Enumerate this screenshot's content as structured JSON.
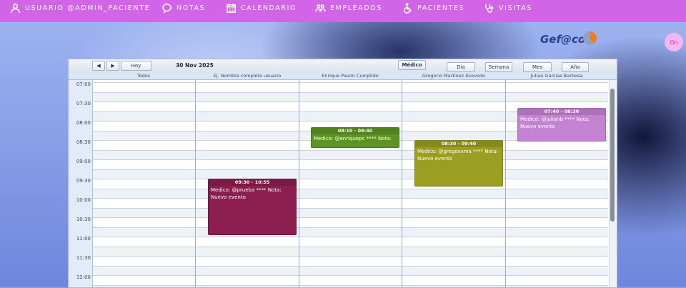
{
  "nav": [
    {
      "label": "Usuario @admin_paciente",
      "icon": "user-icon"
    },
    {
      "label": "Notas",
      "icon": "chat-bubble-icon"
    },
    {
      "label": "Calendario",
      "icon": "calendar-icon"
    },
    {
      "label": "Empleados",
      "icon": "users-icon"
    },
    {
      "label": "Pacientes",
      "icon": "wheelchair-icon"
    },
    {
      "label": "Visitas",
      "icon": "stethoscope-icon"
    }
  ],
  "brand": {
    "logo_text": "Gef@co"
  },
  "session": {
    "on_label": "On"
  },
  "toolbar": {
    "prev_label": "◀",
    "next_label": "▶",
    "today_label": "Hoy",
    "date": "30 Nov 2025",
    "filter_label": "Médico",
    "views": [
      "Día",
      "Semana",
      "Mes",
      "Año"
    ]
  },
  "columns": [
    "Todos",
    "Ej. Nombre completo usuario",
    "Enrique Pavon Cumplido",
    "Gregorio Martinez Acevedo",
    "Julian Garcias Barbosa"
  ],
  "times": [
    "07:00",
    "07:30",
    "08:00",
    "08:30",
    "09:00",
    "09:30",
    "10:00",
    "10:30",
    "11:00",
    "11:30",
    "12:00"
  ],
  "events": [
    {
      "col": 1,
      "time": "09:30 - 10:55",
      "text": "Medico: @prueba **** Nota: Nuevo evento",
      "color": "#8b1e4f",
      "start_min": 570,
      "end_min": 655
    },
    {
      "col": 2,
      "time": "08:10 - 08:40",
      "text": "Medico: @enriquepc **** Nota:",
      "color": "#5c9322",
      "start_min": 490,
      "end_min": 520
    },
    {
      "col": 3,
      "time": "08:30 - 09:40",
      "text": "Medico: @gregoxxma **** Nota: Nuevo evento",
      "color": "#9a9f22",
      "start_min": 510,
      "end_min": 580
    },
    {
      "col": 4,
      "time": "07:40 - 08:30",
      "text": "Medico: @julianb **** Nota: Nuevo evento",
      "color": "#c482d2",
      "start_min": 460,
      "end_min": 510
    }
  ]
}
